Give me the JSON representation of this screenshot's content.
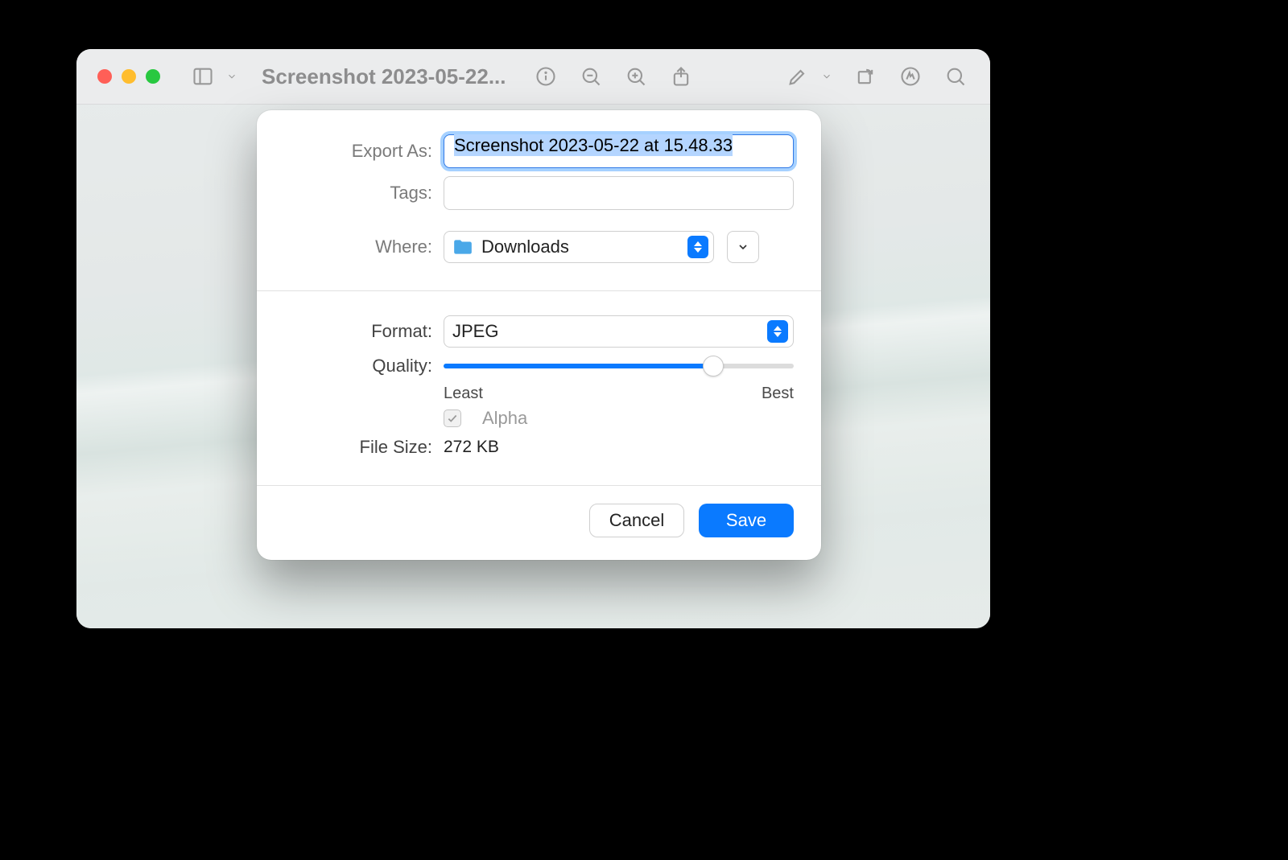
{
  "window": {
    "title": "Screenshot 2023-05-22..."
  },
  "dialog": {
    "export_as_label": "Export As:",
    "export_as_value": "Screenshot 2023-05-22 at 15.48.33",
    "tags_label": "Tags:",
    "tags_value": "",
    "where_label": "Where:",
    "where_value": "Downloads",
    "format_label": "Format:",
    "format_value": "JPEG",
    "quality_label": "Quality:",
    "quality_least": "Least",
    "quality_best": "Best",
    "quality_percent": 77,
    "alpha_label": "Alpha",
    "alpha_checked": true,
    "alpha_enabled": false,
    "filesize_label": "File Size:",
    "filesize_value": "272 KB",
    "cancel_label": "Cancel",
    "save_label": "Save"
  },
  "icons": {
    "sidebar": "sidebar-icon",
    "info": "info-icon",
    "zoom_out": "zoom-out-icon",
    "zoom_in": "zoom-in-icon",
    "share": "share-icon",
    "markup": "markup-icon",
    "rotate": "rotate-icon",
    "annotate": "highlighter-icon",
    "search": "search-icon"
  },
  "colors": {
    "accent": "#0a7aff"
  }
}
